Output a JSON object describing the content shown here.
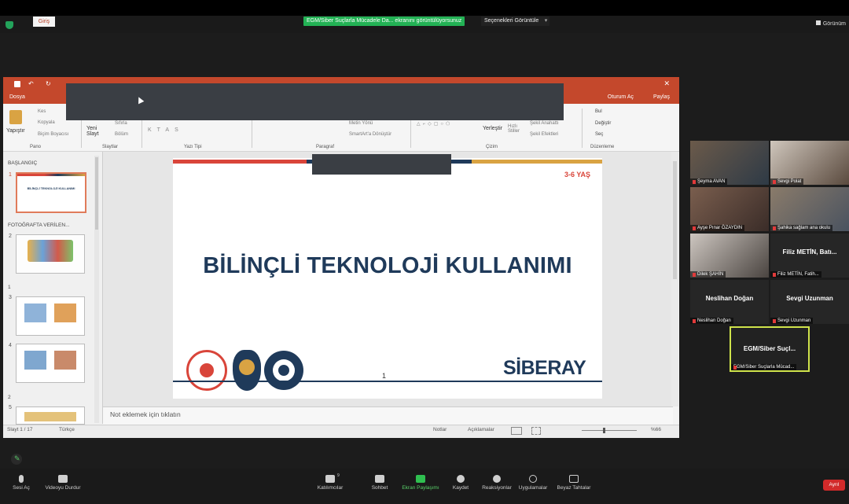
{
  "zoom": {
    "share_banner": "EGM/Siber Suçlarla Mücadele Da... ekranını görüntülüyorsunuz",
    "view_options": "Seçenekleri Görüntüle",
    "view_mode": "Görünüm"
  },
  "ppt": {
    "tabs": [
      "Dosya",
      "Giriş"
    ],
    "tabs_right": [
      "Oturum Aç",
      "Paylaş"
    ],
    "ribbon": {
      "paste": "Yapıştır",
      "cut": "Kes",
      "copy": "Kopyala",
      "format_painter": "Biçim Boyacısı",
      "new_slide": "Yeni Slayt",
      "reset": "Sıfırla",
      "section": "Bölüm",
      "text_direction": "Metin Yönü",
      "smartart": "SmartArt'a Dönüştür",
      "arrange": "Yerleştir",
      "quick_styles": "Hızlı Stiller",
      "shape_outline": "Şekil Anahattı",
      "shape_effects": "Şekil Efektleri",
      "find": "Bul",
      "replace": "Değiştir",
      "select": "Seç",
      "groups": [
        "Pano",
        "Slaytlar",
        "Yazı Tipi",
        "Paragraf",
        "Çizim",
        "Düzenleme"
      ]
    },
    "sections": [
      "BAŞLANGIÇ",
      "FOTOĞRAFTA VERİLEN...",
      "1",
      "2"
    ],
    "slide_numbers": [
      "1",
      "2",
      "3",
      "4",
      "5"
    ],
    "thumb1_title": "BİLİNÇLİ TEKNOLOJİ KULLANIMI",
    "slide": {
      "age": "3-6 YAŞ",
      "title": "BİLİNÇLİ TEKNOLOJİ KULLANIMI",
      "page_number": "1",
      "brand": "SİBERAY"
    },
    "notes_placeholder": "Not eklemek için tıklatın",
    "status": {
      "slide_count": "Slayt 1 / 17",
      "language": "Türkçe",
      "notes": "Notlar",
      "comments": "Açıklamalar",
      "zoom": "%66"
    }
  },
  "gallery": [
    {
      "name": "Şeyma AVAN",
      "video": true
    },
    {
      "name": "Sevgi Polat",
      "video": true
    },
    {
      "name": "Ayşe Pınar ÖZAYDIN",
      "video": true
    },
    {
      "name": "Şahika sağlam ana okulu",
      "video": true
    },
    {
      "name": "Dilek ŞAHİN",
      "video": true
    },
    {
      "name": "Filiz METİN, Fatih...",
      "big": "Filiz METİN, Batı...",
      "video": false
    },
    {
      "name": "Neslihan Doğan",
      "big": "Neslihan Doğan",
      "video": false
    },
    {
      "name": "Sevgi Uzunman",
      "big": "Sevgi Uzunman",
      "video": false
    }
  ],
  "active_speaker": {
    "big": "EGM/Siber  Suçl...",
    "name": "EGM/Siber Suçlarla Mücad..."
  },
  "toolbar": {
    "mute": "Sesi Aç",
    "video": "Videoyu Durdur",
    "participants": "Katılımcılar",
    "participant_count": "9",
    "chat": "Sohbet",
    "share": "Ekran Paylaşımı",
    "record": "Kaydet",
    "reactions": "Reaksiyonlar",
    "apps": "Uygulamalar",
    "whiteboard": "Beyaz Tahtalar",
    "end": "Ayrıl"
  }
}
